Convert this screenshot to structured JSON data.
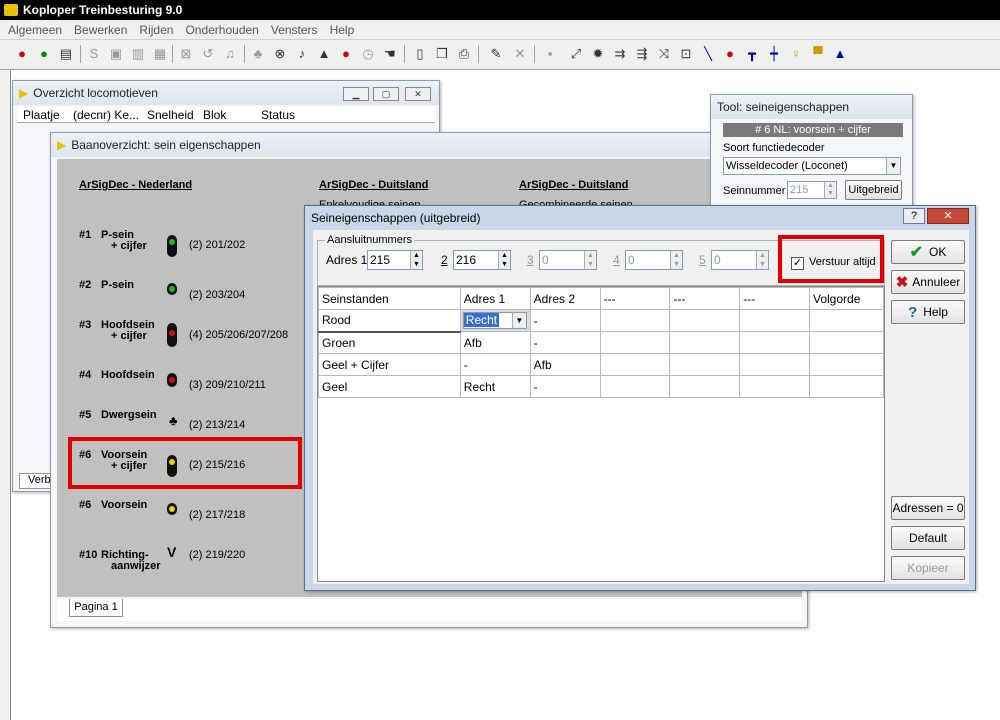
{
  "app": {
    "title": "Koploper Treinbesturing 9.0"
  },
  "menu": [
    "Algemeen",
    "Bewerken",
    "Rijden",
    "Onderhouden",
    "Vensters",
    "Help"
  ],
  "loco_window": {
    "title": "Overzicht locomotieven",
    "columns": [
      "Plaatje",
      "(decnr) Ke...",
      "Snelheid",
      "Blok",
      "Status"
    ],
    "tab_partial": "Verb"
  },
  "baan_window": {
    "title": "Baanoverzicht: sein eigenschappen",
    "col1_header": "ArSigDec - Nederland",
    "col2_header": "ArSigDec - Duitsland",
    "col2_sub": "Enkelvoudige seinen",
    "col3_header": "ArSigDec - Duitsland",
    "col3_sub": "Gecombineerde seinen",
    "signals": [
      {
        "num": "#1",
        "name": "P-sein",
        "sub": "+ cijfer",
        "addr": "(2)  201/202"
      },
      {
        "num": "#2",
        "name": "P-sein",
        "sub": "",
        "addr": "(2)  203/204"
      },
      {
        "num": "#3",
        "name": "Hoofdsein",
        "sub": "+ cijfer",
        "addr": "(4)  205/206/207/208"
      },
      {
        "num": "#4",
        "name": "Hoofdsein",
        "sub": "",
        "addr": "(3)  209/210/211"
      },
      {
        "num": "#5",
        "name": "Dwergsein",
        "sub": "",
        "addr": "(2)  213/214"
      },
      {
        "num": "#6",
        "name": "Voorsein",
        "sub": "+ cijfer",
        "addr": "(2)  215/216"
      },
      {
        "num": "#6",
        "name": "Voorsein",
        "sub": "",
        "addr": "(2)  217/218"
      },
      {
        "num": "#10",
        "name": "Richting-",
        "sub": "aanwijzer",
        "addr": "(2)  219/220"
      }
    ],
    "tab": "Pagina 1"
  },
  "tool_window": {
    "title": "Tool: seineigenschappen",
    "header": "# 6 NL: voorsein + cijfer",
    "decoder_label": "Soort functiedecoder",
    "decoder_value": "Wisseldecoder (Loconet)",
    "seinnummer_label": "Seinnummer",
    "seinnummer_value": "215",
    "uitgebreid_button": "Uitgebreid"
  },
  "dialog": {
    "title": "Seineigenschappen (uitgebreid)",
    "help_btn": "?",
    "close_btn": "✕",
    "group_label": "Aansluitnummers",
    "addr1_label": "Adres 1",
    "addr1_value": "215",
    "addr2_label": "2",
    "addr2_value": "216",
    "addr3_label": "3",
    "addr3_value": "0",
    "addr4_label": "4",
    "addr4_value": "0",
    "addr5_label": "5",
    "addr5_value": "0",
    "checkbox_label": "Verstuur altijd",
    "checkbox_checked": "✓",
    "table_headers": [
      "Seinstanden",
      "Adres 1",
      "Adres 2",
      "---",
      "---",
      "---",
      "Volgorde"
    ],
    "rows": [
      {
        "state": "Rood",
        "a1": "Recht",
        "a2": "-"
      },
      {
        "state": "Groen",
        "a1": "Afb",
        "a2": "-"
      },
      {
        "state": "Geel + Cijfer",
        "a1": "-",
        "a2": "Afb"
      },
      {
        "state": "Geel",
        "a1": "Recht",
        "a2": "-"
      }
    ],
    "ok": "OK",
    "cancel": "Annuleer",
    "help": "Help",
    "adressen": "Adressen = 0",
    "default": "Default",
    "kopieer": "Kopieer"
  },
  "colors": {
    "highlight_red": "#e00000",
    "signal_green": "#22b822",
    "signal_red": "#d01010",
    "signal_yellow": "#e8d000"
  }
}
